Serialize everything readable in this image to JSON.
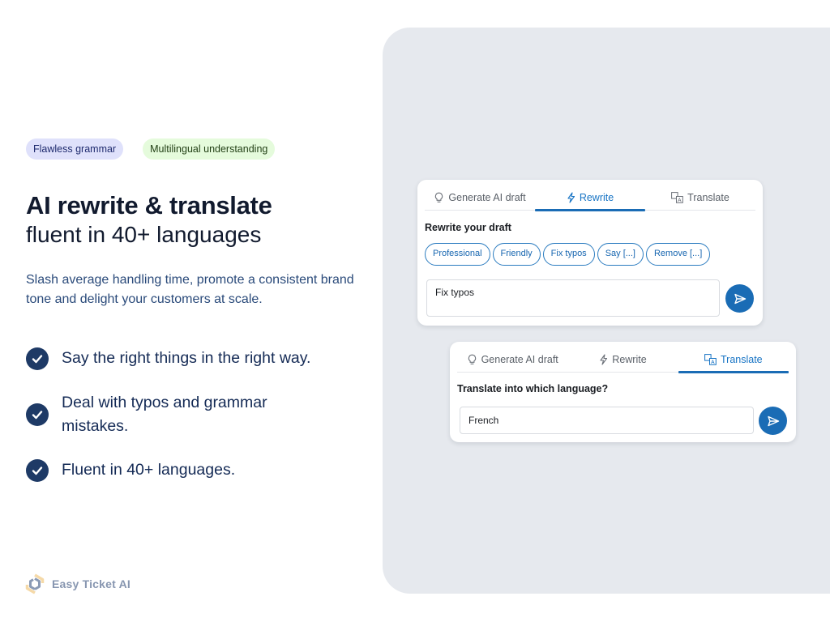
{
  "badges": [
    {
      "label": "Flawless grammar",
      "color": "#dfe1fb"
    },
    {
      "label": "Multilingual understanding",
      "color": "#e5fbdc"
    }
  ],
  "hero": {
    "title": "AI rewrite & translate",
    "subtitle": "fluent in 40+ languages",
    "lead": "Slash average handling time, promote a consistent brand tone and delight your customers at scale."
  },
  "features": [
    {
      "icon": "check-circle-icon",
      "text": "Say the right things in the right way."
    },
    {
      "icon": "check-circle-icon",
      "text": "Deal with typos and grammar mistakes."
    },
    {
      "icon": "check-circle-icon",
      "text": "Fluent in 40+ languages."
    }
  ],
  "brand": {
    "name": "Easy Ticket AI",
    "logo_icon": "hexagon-logo-icon"
  },
  "colors": {
    "accent": "#1a6cb5",
    "check_icon": "#1e3a66",
    "panel_bg": "#e6e9ee"
  },
  "rewrite_card": {
    "tabs": [
      {
        "label": "Generate AI draft",
        "icon": "lightbulb-icon",
        "active": false
      },
      {
        "label": "Rewrite",
        "icon": "lightning-icon",
        "active": true
      },
      {
        "label": "Translate",
        "icon": "translate-icon",
        "active": false
      }
    ],
    "heading": "Rewrite your draft",
    "chips": [
      "Professional",
      "Friendly",
      "Fix typos",
      "Say [...]",
      "Remove [...]"
    ],
    "input_value": "Fix typos",
    "send_icon": "send-icon"
  },
  "translate_card": {
    "tabs": [
      {
        "label": "Generate AI draft",
        "icon": "lightbulb-icon",
        "active": false
      },
      {
        "label": "Rewrite",
        "icon": "lightning-icon",
        "active": false
      },
      {
        "label": "Translate",
        "icon": "translate-icon",
        "active": true
      }
    ],
    "heading": "Translate into which language?",
    "input_value": "French",
    "send_icon": "send-icon"
  }
}
